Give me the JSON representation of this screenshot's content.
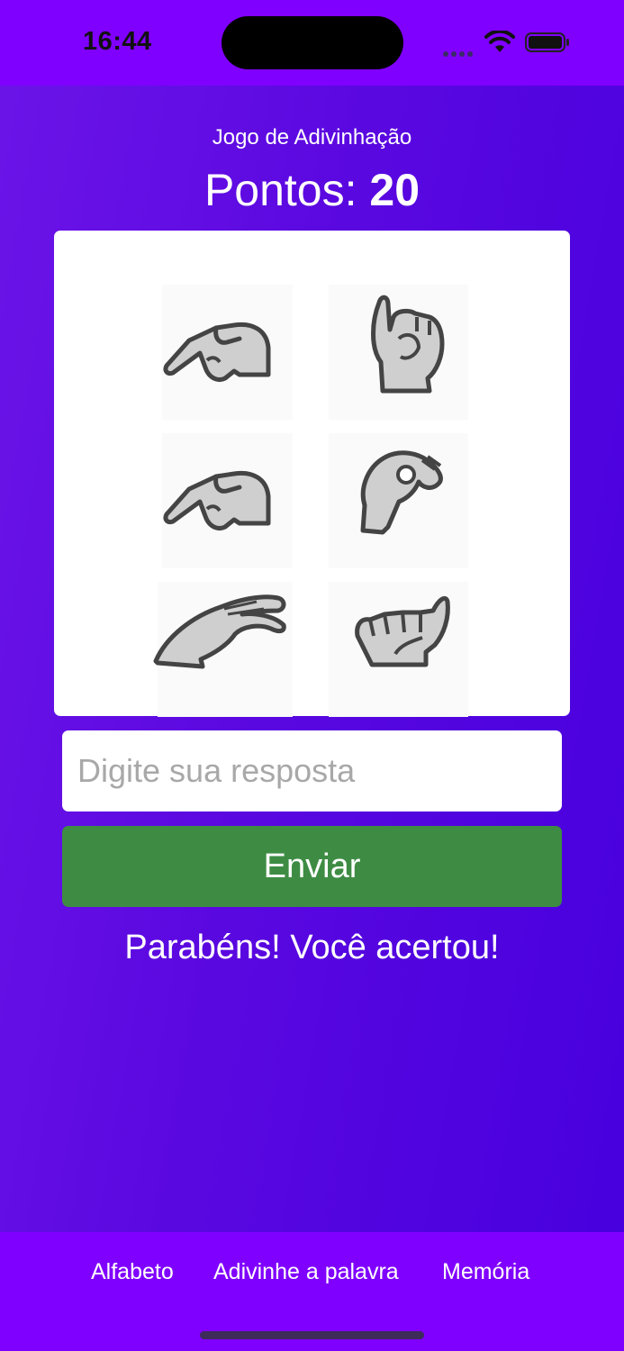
{
  "status_bar": {
    "time": "16:44"
  },
  "game": {
    "title": "Jogo de Adivinhação",
    "score_label": "Pontos: ",
    "score_value": "20",
    "letter_signs": [
      "G",
      "I",
      "G",
      "O",
      "C",
      "A"
    ]
  },
  "answer": {
    "placeholder": "Digite sua resposta",
    "value": ""
  },
  "submit": {
    "label": "Enviar"
  },
  "feedback": {
    "message": "Parabéns! Você acertou!"
  },
  "tabs": [
    {
      "label": "Alfabeto"
    },
    {
      "label": "Adivinhe a palavra"
    },
    {
      "label": "Memória"
    }
  ],
  "colors": {
    "header_purple": "#8000ff",
    "gradient_start": "#6b14e8",
    "gradient_end": "#4700de",
    "submit_green": "#3e8c43"
  }
}
